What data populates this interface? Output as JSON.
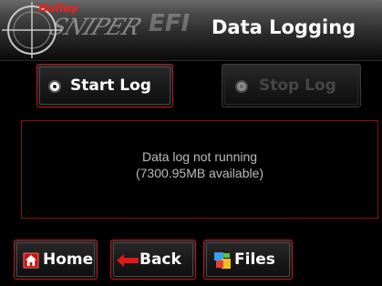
{
  "header": {
    "brand_top": "Holley",
    "brand_main": "SNIPER",
    "brand_efi": "EFI",
    "title": "Data Logging"
  },
  "controls": {
    "start_label": "Start Log",
    "stop_label": "Stop Log",
    "stop_enabled": false
  },
  "status": {
    "line1": "Data log not running",
    "line2": "(7300.95MB available)"
  },
  "nav": {
    "home_label": "Home",
    "back_label": "Back",
    "files_label": "Files"
  },
  "colors": {
    "accent": "#c21414",
    "brand_red": "#ff1a1a",
    "status_text": "#bcbcbc",
    "disabled_text": "#464646"
  },
  "icons": {
    "crosshair": "crosshair-icon",
    "radio": "radio-button-icon",
    "home": "home-icon",
    "back": "back-arrow-icon",
    "files": "files-icon"
  }
}
